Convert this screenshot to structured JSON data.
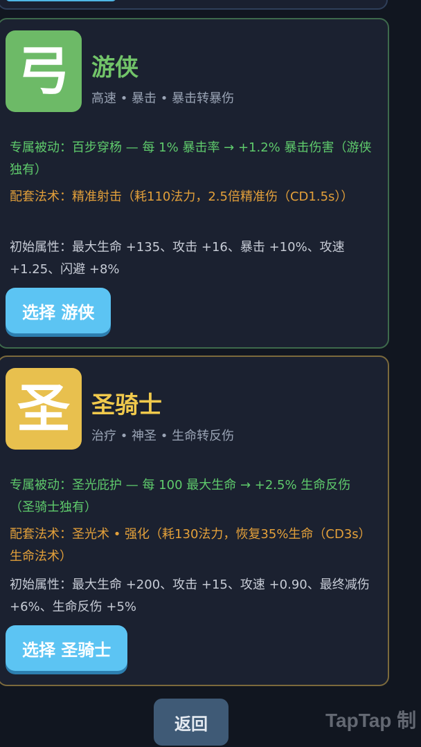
{
  "classes": [
    {
      "icon_char": "弓",
      "name": "游侠",
      "tags": "高速 • 暴击 • 暴击转暴伤",
      "passive": "专属被动：百步穿杨 — 每 1% 暴击率 → +1.2% 暴击伤害（游侠独有）",
      "spell": "配套法术：精准射击（耗110法力，2.5倍精准伤（CD1.5s））",
      "stats": "初始属性：最大生命 +135、攻击 +16、暴击 +10%、攻速 +1.25、闪避 +8%",
      "select_label": "选择 游侠",
      "accent": "#72c469",
      "icon_bg": "#6dba67"
    },
    {
      "icon_char": "圣",
      "name": "圣骑士",
      "tags": "治疗 • 神圣 • 生命转反伤",
      "passive": "专属被动：圣光庇护 — 每 100 最大生命 → +2.5% 生命反伤（圣骑士独有）",
      "spell": "配套法术：圣光术 • 强化（耗130法力，恢复35%生命（CD3s）生命法术）",
      "stats": "初始属性：最大生命 +200、攻击 +15、攻速 +0.90、最终减伤 +6%、生命反伤 +5%",
      "select_label": "选择 圣骑士",
      "accent": "#f0c94c",
      "icon_bg": "#e8c04e"
    }
  ],
  "back_label": "返回",
  "watermark": "TapTap 制"
}
